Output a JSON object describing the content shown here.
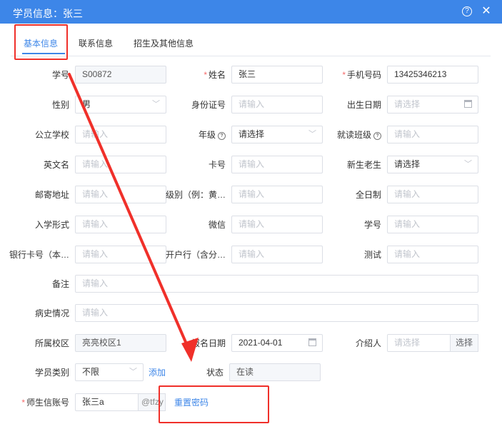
{
  "dialog": {
    "title": "学员信息：张三",
    "help_glyph": "?",
    "close_glyph": "✕"
  },
  "tabs": [
    {
      "label": "基本信息",
      "active": true
    },
    {
      "label": "联系信息",
      "active": false
    },
    {
      "label": "招生及其他信息",
      "active": false
    }
  ],
  "form": {
    "row1": {
      "student_no": {
        "label": "学号",
        "value": "S00872"
      },
      "name": {
        "label": "姓名",
        "required": "*",
        "value": "张三"
      },
      "phone": {
        "label": "手机号码",
        "required": "*",
        "value": "13425346213"
      }
    },
    "row2": {
      "gender": {
        "label": "性别",
        "value": "男"
      },
      "id_card": {
        "label": "身份证号",
        "placeholder": "请输入"
      },
      "birth_date": {
        "label": "出生日期",
        "placeholder": "请选择"
      }
    },
    "row3": {
      "public_school": {
        "label": "公立学校",
        "placeholder": "请输入"
      },
      "grade": {
        "label": "年级",
        "placeholder": "请选择"
      },
      "class": {
        "label": "就读班级",
        "placeholder": "请输入"
      }
    },
    "row4": {
      "english_name": {
        "label": "英文名",
        "placeholder": "请输入"
      },
      "card_no": {
        "label": "卡号",
        "placeholder": "请输入"
      },
      "new_old": {
        "label": "新生老生",
        "placeholder": "请选择"
      }
    },
    "row5": {
      "mail_address": {
        "label": "邮寄地址",
        "placeholder": "请输入"
      },
      "level": {
        "label": "级别（例：黄…",
        "placeholder": "请输入"
      },
      "full_time": {
        "label": "全日制",
        "placeholder": "请输入"
      }
    },
    "row6": {
      "admission_type": {
        "label": "入学形式",
        "placeholder": "请输入"
      },
      "wechat": {
        "label": "微信",
        "placeholder": "请输入"
      },
      "student_no2": {
        "label": "学号",
        "placeholder": "请输入"
      }
    },
    "row7": {
      "bank_card": {
        "label": "银行卡号（本…",
        "placeholder": "请输入"
      },
      "bank_name": {
        "label": "开户行（含分…",
        "placeholder": "请输入"
      },
      "test": {
        "label": "测试",
        "placeholder": "请输入"
      }
    },
    "remark": {
      "label": "备注",
      "placeholder": "请输入"
    },
    "medical": {
      "label": "病史情况",
      "placeholder": "请输入"
    },
    "row10": {
      "campus": {
        "label": "所属校区",
        "value": "亮亮校区1"
      },
      "signup_date": {
        "label": "报名日期",
        "value": "2021-04-01"
      },
      "referrer": {
        "label": "介绍人",
        "placeholder": "请选择",
        "button": "选择"
      }
    },
    "row11": {
      "category": {
        "label": "学员类别",
        "value": "不限",
        "add_link": "添加"
      },
      "status": {
        "label": "状态",
        "value": "在读"
      }
    },
    "account": {
      "label": "师生信账号",
      "required": "*",
      "value": "张三a",
      "suffix": "@tfzy",
      "reset_link": "重置密码"
    }
  },
  "annotations": {
    "color": "#f0302a"
  }
}
